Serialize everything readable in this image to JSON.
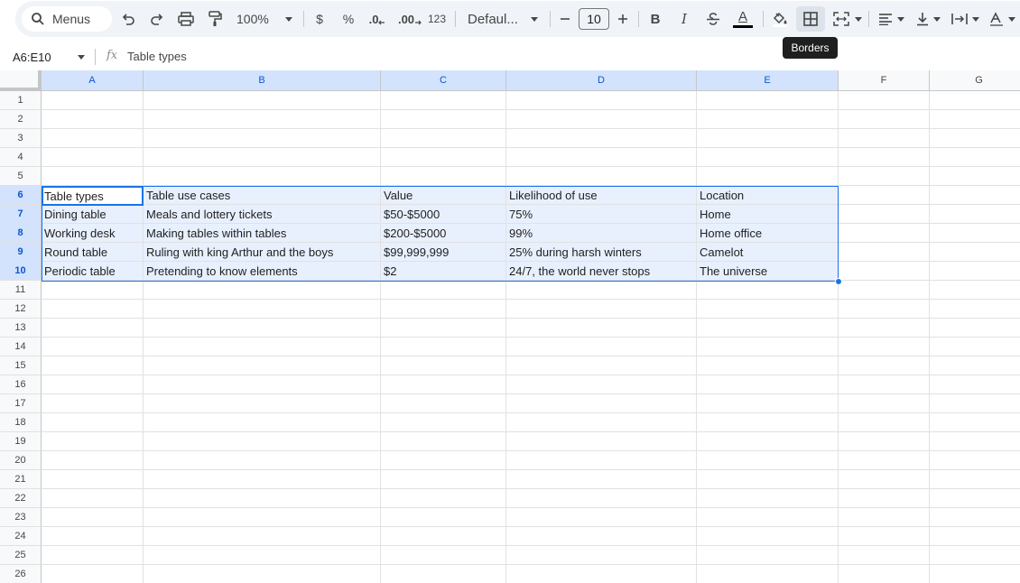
{
  "toolbar": {
    "search_label": "Menus",
    "zoom": "100%",
    "currency": "$",
    "percent": "%",
    "dec_decrease": ".0",
    "dec_increase": ".00",
    "number_format": "123",
    "font": "Defaul...",
    "font_size": "10",
    "bold": "B",
    "italic": "I",
    "text_color": "A",
    "tooltip": "Borders",
    "accent_color": "#1a73e8"
  },
  "formula_bar": {
    "name_box": "A6:E10",
    "fx": "fx",
    "content": "Table types"
  },
  "columns": [
    "A",
    "B",
    "C",
    "D",
    "E",
    "F",
    "G"
  ],
  "rows": [
    "1",
    "2",
    "3",
    "4",
    "5",
    "6",
    "7",
    "8",
    "9",
    "10",
    "11",
    "12",
    "13",
    "14",
    "15",
    "16",
    "17",
    "18",
    "19",
    "20",
    "21",
    "22",
    "23",
    "24",
    "25",
    "26"
  ],
  "table": [
    [
      "Table types",
      "Table use cases",
      "Value",
      "Likelihood of use",
      "Location"
    ],
    [
      "Dining table",
      "Meals and lottery tickets",
      "$50-$5000",
      "75%",
      "Home"
    ],
    [
      "Working desk",
      "Making tables within tables",
      "$200-$5000",
      "99%",
      "Home office"
    ],
    [
      "Round table",
      "Ruling with king Arthur and the boys",
      "$99,999,999",
      "25% during harsh winters",
      "Camelot"
    ],
    [
      "Periodic table",
      "Pretending to know elements",
      "$2",
      "24/7, the world never stops",
      "The universe"
    ]
  ]
}
